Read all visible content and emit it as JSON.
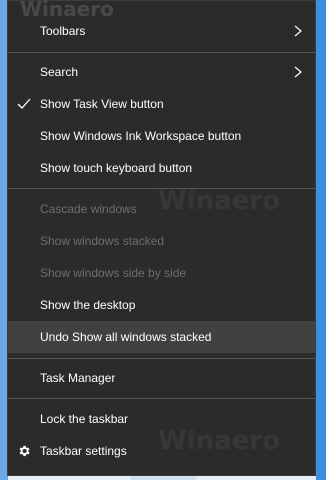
{
  "watermarks": [
    "Winaero",
    "Winaero",
    "Winaero"
  ],
  "menu": {
    "items": [
      {
        "label": "Toolbars",
        "enabled": true,
        "submenu": true
      },
      {
        "label": "Search",
        "enabled": true,
        "submenu": true
      },
      {
        "label": "Show Task View button",
        "enabled": true,
        "checked": true
      },
      {
        "label": "Show Windows Ink Workspace button",
        "enabled": true
      },
      {
        "label": "Show touch keyboard button",
        "enabled": true
      },
      {
        "label": "Cascade windows",
        "enabled": false
      },
      {
        "label": "Show windows stacked",
        "enabled": false
      },
      {
        "label": "Show windows side by side",
        "enabled": false
      },
      {
        "label": "Show the desktop",
        "enabled": true
      },
      {
        "label": "Undo Show all windows stacked",
        "enabled": true,
        "highlighted": true
      },
      {
        "label": "Task Manager",
        "enabled": true
      },
      {
        "label": "Lock the taskbar",
        "enabled": true
      },
      {
        "label": "Taskbar settings",
        "enabled": true,
        "icon": "gear-icon"
      }
    ]
  },
  "colors": {
    "menu_bg": "#2b2b2b",
    "hover_bg": "#414141",
    "text": "#ffffff",
    "disabled_text": "#6e6e6e",
    "separator": "#555555"
  }
}
